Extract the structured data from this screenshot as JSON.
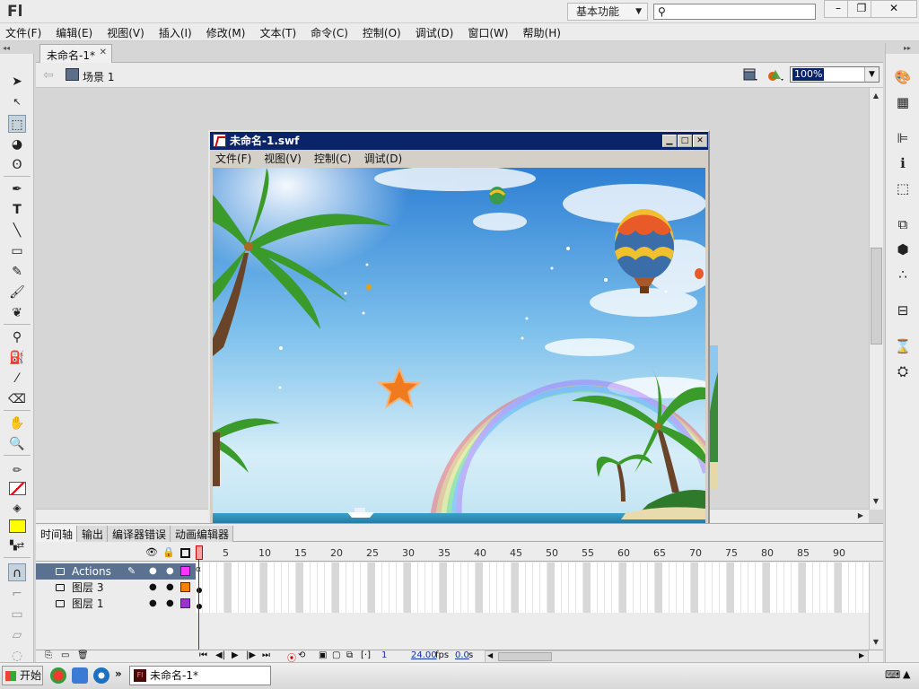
{
  "app": {
    "logo": "Fl",
    "workspace": "基本功能",
    "window_buttons": [
      "–",
      "❐",
      "✕"
    ]
  },
  "menubar": [
    "文件(F)",
    "编辑(E)",
    "视图(V)",
    "插入(I)",
    "修改(M)",
    "文本(T)",
    "命令(C)",
    "控制(O)",
    "调试(D)",
    "窗口(W)",
    "帮助(H)"
  ],
  "document": {
    "tab_label": "未命名-1*",
    "scene_label": "场景 1",
    "zoom": "100%"
  },
  "swf_window": {
    "title": "未命名-1.swf",
    "menu": [
      "文件(F)",
      "视图(V)",
      "控制(C)",
      "调试(D)"
    ]
  },
  "timeline": {
    "tabs": [
      "时间轴",
      "输出",
      "编译器错误",
      "动画编辑器"
    ],
    "frame_numbers": [
      "1",
      "5",
      "10",
      "15",
      "20",
      "25",
      "30",
      "35",
      "40",
      "45",
      "50",
      "55",
      "60",
      "65",
      "70",
      "75",
      "80",
      "85",
      "90"
    ],
    "layers": [
      {
        "name": "Actions",
        "color": "#ff33ff",
        "selected": true
      },
      {
        "name": "图层 3",
        "color": "#ff8000",
        "selected": false
      },
      {
        "name": "图层 1",
        "color": "#9933cc",
        "selected": false
      }
    ],
    "current_frame": "1",
    "fps": "24.00",
    "fps_unit": "fps",
    "time": "0.0",
    "time_unit": "s"
  },
  "taskbar": {
    "start_label": "开始",
    "task_label": "未命名-1*",
    "overflow": "»"
  },
  "colors": {
    "stroke": "#000000",
    "fill": "#ffff00",
    "selection": "#0a246a"
  }
}
